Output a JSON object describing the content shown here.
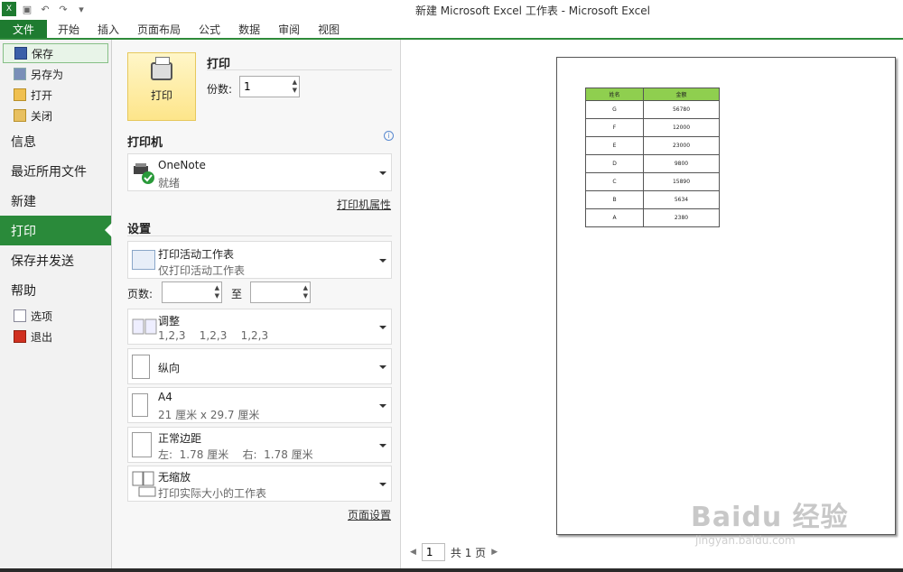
{
  "window": {
    "title": "新建 Microsoft Excel 工作表 - Microsoft Excel"
  },
  "tabs": [
    "文件",
    "开始",
    "插入",
    "页面布局",
    "公式",
    "数据",
    "审阅",
    "视图"
  ],
  "nav": {
    "top_items": [
      {
        "label": "保存",
        "icon": "save-icon"
      },
      {
        "label": "另存为",
        "icon": "save-as-icon"
      },
      {
        "label": "打开",
        "icon": "open-folder-icon"
      },
      {
        "label": "关闭",
        "icon": "close-folder-icon"
      }
    ],
    "big_items": [
      "信息",
      "最近所用文件",
      "新建",
      "打印",
      "保存并发送",
      "帮助"
    ],
    "bottom_items": [
      {
        "label": "选项",
        "icon": "options-icon"
      },
      {
        "label": "退出",
        "icon": "exit-icon"
      }
    ]
  },
  "print": {
    "button_label": "打印",
    "heading": "打印",
    "copies_label": "份数:",
    "copies_value": "1"
  },
  "printer": {
    "heading": "打印机",
    "name": "OneNote",
    "status": "就绪",
    "properties_link": "打印机属性"
  },
  "settings": {
    "heading": "设置",
    "scope": {
      "main": "打印活动工作表",
      "sub": "仅打印活动工作表"
    },
    "pages_label": "页数:",
    "pages_to": "至",
    "collate": {
      "main": "调整",
      "sub": "1,2,3    1,2,3    1,2,3"
    },
    "orientation": {
      "main": "纵向"
    },
    "paper": {
      "main": "A4",
      "sub": "21 厘米 x 29.7 厘米"
    },
    "margins": {
      "main": "正常边距",
      "sub": "左:  1.78 厘米    右:  1.78 厘米"
    },
    "scaling": {
      "main": "无缩放",
      "sub": "打印实际大小的工作表"
    },
    "page_setup_link": "页面设置"
  },
  "preview": {
    "table": {
      "headers": [
        "姓名",
        "金额"
      ],
      "rows": [
        [
          "G",
          "56780"
        ],
        [
          "F",
          "12000"
        ],
        [
          "E",
          "23000"
        ],
        [
          "D",
          "9800"
        ],
        [
          "C",
          "15890"
        ],
        [
          "B",
          "5634"
        ],
        [
          "A",
          "2380"
        ]
      ]
    },
    "page_current": "1",
    "page_total": "共 1 页"
  },
  "watermark": {
    "main": "Baidu 经验",
    "sub": "jingyan.baidu.com"
  },
  "colors": {
    "accent": "#2a8a3a",
    "file_tab": "#1e7b30",
    "header_green": "#8fcf4f"
  }
}
